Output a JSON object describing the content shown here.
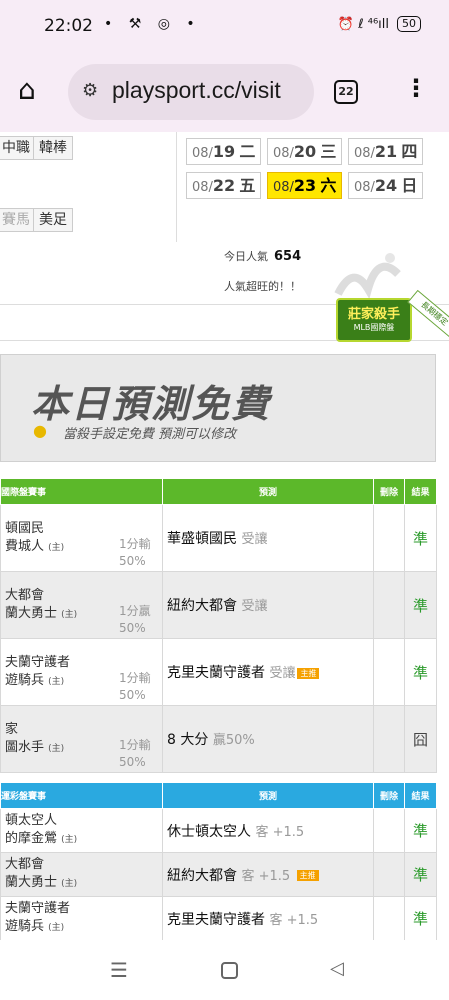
{
  "status": {
    "time": "22:02",
    "icons_left": "• ⚒ ◎ •",
    "icons_right": "⏰ ℓ ⁴⁶ıll",
    "battery": "50"
  },
  "browser": {
    "url": "playsport.cc/visit",
    "tab_count": "22"
  },
  "sports": {
    "row1": [
      "中職",
      "韓棒"
    ],
    "row2": [
      "賽馬",
      "美足"
    ]
  },
  "dates": [
    {
      "prefix": "08/",
      "day": "19",
      "wd": "二"
    },
    {
      "prefix": "08/",
      "day": "20",
      "wd": "三"
    },
    {
      "prefix": "08/",
      "day": "21",
      "wd": "四"
    },
    {
      "prefix": "08/",
      "day": "22",
      "wd": "五"
    },
    {
      "prefix": "08/",
      "day": "23",
      "wd": "六"
    },
    {
      "prefix": "08/",
      "day": "24",
      "wd": "日"
    }
  ],
  "popularity": {
    "label": "今日人氣",
    "value": "654",
    "note": "人氣超旺的！！"
  },
  "badge": {
    "title": "莊家殺手",
    "sub": "MLB國際盤",
    "ribbon": "長期穩定"
  },
  "banner": {
    "title": "本日預測免費",
    "subtitle": "當殺手設定免費 預測可以修改"
  },
  "table1": {
    "headers": [
      "國際盤賽事",
      "預測",
      "刪除",
      "結果"
    ],
    "rows": [
      {
        "team1": "頓國民",
        "team2": "費城人",
        "home": "(主)",
        "h1": "1分輸",
        "h2": "50%",
        "pred": "華盛頓國民",
        "pred_note": "受讓",
        "home_tag": "",
        "result": "準"
      },
      {
        "team1": "大都會",
        "team2": "蘭大勇士",
        "home": "(主)",
        "h1": "1分贏",
        "h2": "50%",
        "pred": "紐約大都會",
        "pred_note": "受讓",
        "home_tag": "",
        "result": "準"
      },
      {
        "team1": "夫蘭守護者",
        "team2": "遊騎兵",
        "home": "(主)",
        "h1": "1分輸",
        "h2": "50%",
        "pred": "克里夫蘭守護者",
        "pred_note": "受讓",
        "home_tag": "主推",
        "result": "準"
      },
      {
        "team1": "家",
        "team2": "圖水手",
        "home": "(主)",
        "h1": "1分輸",
        "h2": "50%",
        "pred": "8 大分",
        "pred_note": "贏50%",
        "home_tag": "",
        "result": "囧"
      }
    ]
  },
  "table2": {
    "headers": [
      "運彩盤賽事",
      "預測",
      "刪除",
      "結果"
    ],
    "rows": [
      {
        "team1": "頓太空人",
        "team2": "的摩金鶯",
        "home": "(主)",
        "pred": "休士頓太空人",
        "pred_note": "客 +1.5",
        "home_tag": "",
        "result": "準"
      },
      {
        "team1": "大都會",
        "team2": "蘭大勇士",
        "home": "(主)",
        "pred": "紐約大都會",
        "pred_note": "客 +1.5",
        "home_tag": "主推",
        "result": "準"
      },
      {
        "team1": "夫蘭守護者",
        "team2": "遊騎兵",
        "home": "(主)",
        "pred": "克里夫蘭守護者",
        "pred_note": "客 +1.5",
        "home_tag": "",
        "result": "準"
      }
    ]
  },
  "nav": {
    "menu": "☰",
    "back": "◁"
  }
}
